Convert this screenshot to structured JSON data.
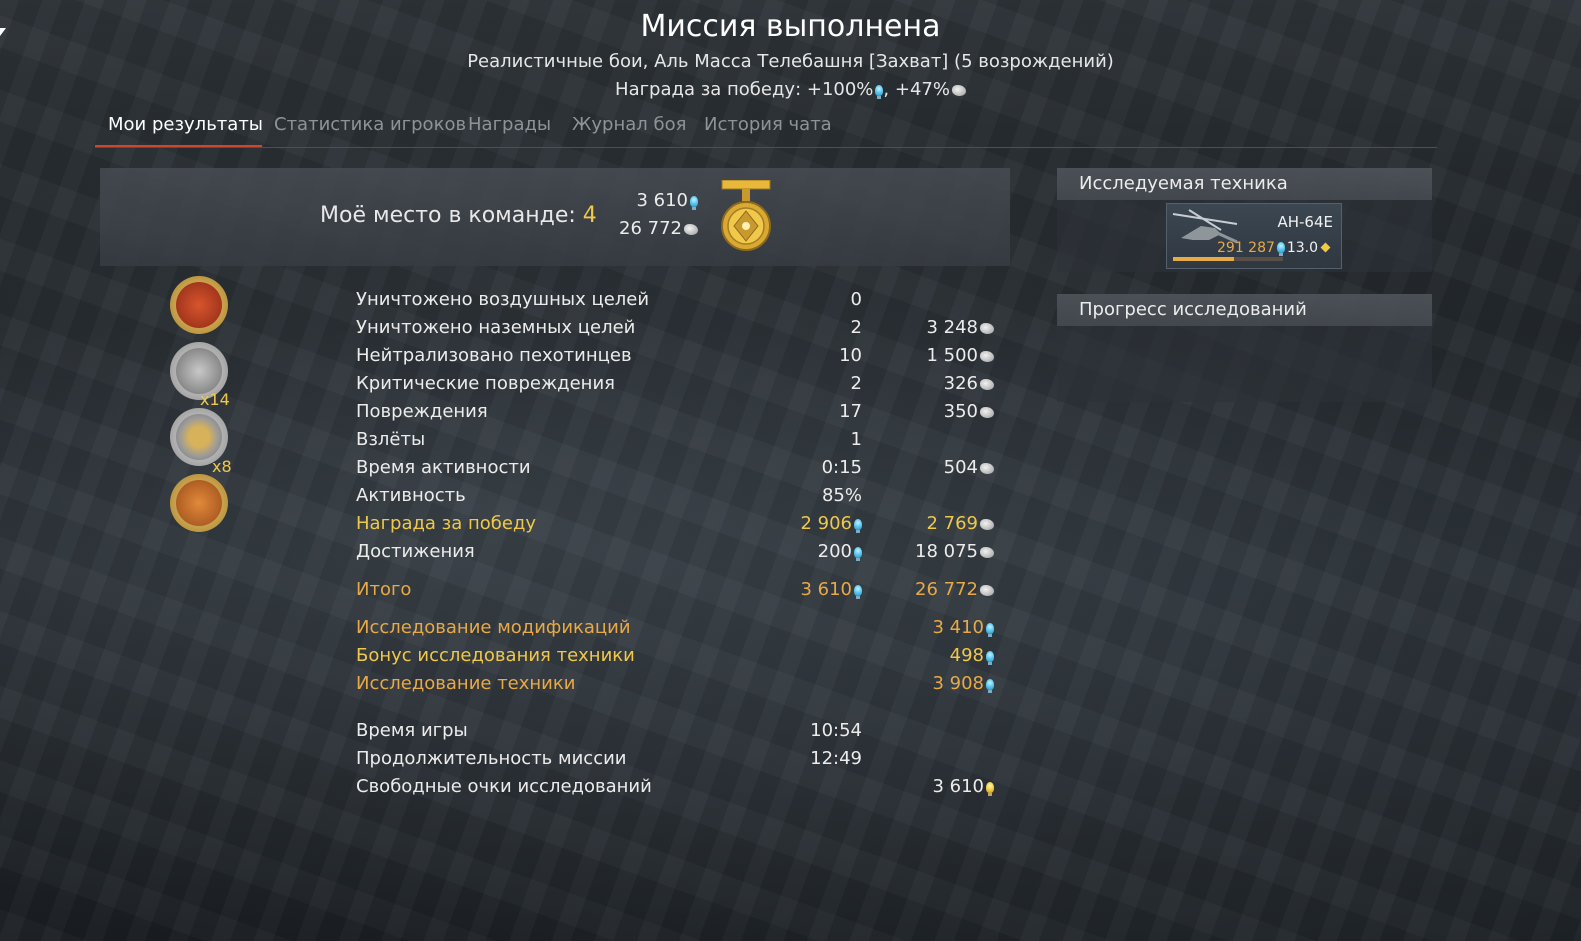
{
  "header": {
    "title": "Миссия выполнена",
    "subtitle": "Реалистичные бои, Аль Масса Телебашня [Захват] (5 возрождений)",
    "reward_prefix": "Награда за победу: +100%",
    "reward_middle": ", +47%"
  },
  "tabs": [
    {
      "label": "Мои результаты",
      "active": true
    },
    {
      "label": "Статистика игроков",
      "active": false
    },
    {
      "label": "Награды",
      "active": false
    },
    {
      "label": "Журнал боя",
      "active": false
    },
    {
      "label": "История чата",
      "active": false
    }
  ],
  "place": {
    "label": "Моё место в команде: ",
    "value": "4",
    "rp": "3 610",
    "sl": "26 772"
  },
  "badges": [
    {
      "icon": "red-award-badge",
      "mult": ""
    },
    {
      "icon": "silver-vehicle-badge",
      "mult": "x14"
    },
    {
      "icon": "silver-shells-badge",
      "mult": "x8"
    },
    {
      "icon": "gold-vehicle-badge",
      "mult": ""
    }
  ],
  "stats": [
    {
      "label": "Уничтожено воздушных целей",
      "v1": "0",
      "v2": "",
      "v2_icon": ""
    },
    {
      "label": "Уничтожено наземных целей",
      "v1": "2",
      "v2": "3 248",
      "v2_icon": "silver-lions-icon"
    },
    {
      "label": "Нейтрализовано пехотинцев",
      "v1": "10",
      "v2": "1 500",
      "v2_icon": "silver-lions-icon"
    },
    {
      "label": "Критические повреждения",
      "v1": "2",
      "v2": "326",
      "v2_icon": "silver-lions-icon"
    },
    {
      "label": "Повреждения",
      "v1": "17",
      "v2": "350",
      "v2_icon": "silver-lions-icon"
    },
    {
      "label": "Взлёты",
      "v1": "1",
      "v2": "",
      "v2_icon": ""
    },
    {
      "label": "Время активности",
      "v1": "0:15",
      "v2": "504",
      "v2_icon": "silver-lions-icon"
    },
    {
      "label": "Активность",
      "v1": "85%",
      "v2": "",
      "v2_icon": ""
    },
    {
      "label": "Награда за победу",
      "v1": "2 906",
      "v2": "2 769",
      "color": "gold"
    },
    {
      "label": "Достижения",
      "v1": "200",
      "v2": "18 075"
    }
  ],
  "total": {
    "label": "Итого",
    "rp": "3 610",
    "sl": "26 772"
  },
  "research": [
    {
      "label": "Исследование модификаций",
      "value": "3 410",
      "color": "orange"
    },
    {
      "label": "Бонус исследования техники",
      "value": "498",
      "color": "gold"
    },
    {
      "label": "Исследование техники",
      "value": "3 908",
      "color": "orange"
    }
  ],
  "times": [
    {
      "label": "Время игры",
      "value": "10:54"
    },
    {
      "label": "Продолжительность миссии",
      "value": "12:49"
    }
  ],
  "free_rp": {
    "label": "Свободные очки исследований",
    "value": "3 610"
  },
  "sidebar": {
    "researched_title": "Исследуемая техника",
    "vehicle": {
      "name": "AH-64E",
      "rp": "291 287",
      "br": "13.0",
      "progress": 0.55
    },
    "progress_title": "Прогресс исследований"
  },
  "colors": {
    "gold": "#f0c84a",
    "orange": "#e8a947",
    "accent_tab": "#d0452b",
    "rp_blue": "#5fc9f1"
  }
}
